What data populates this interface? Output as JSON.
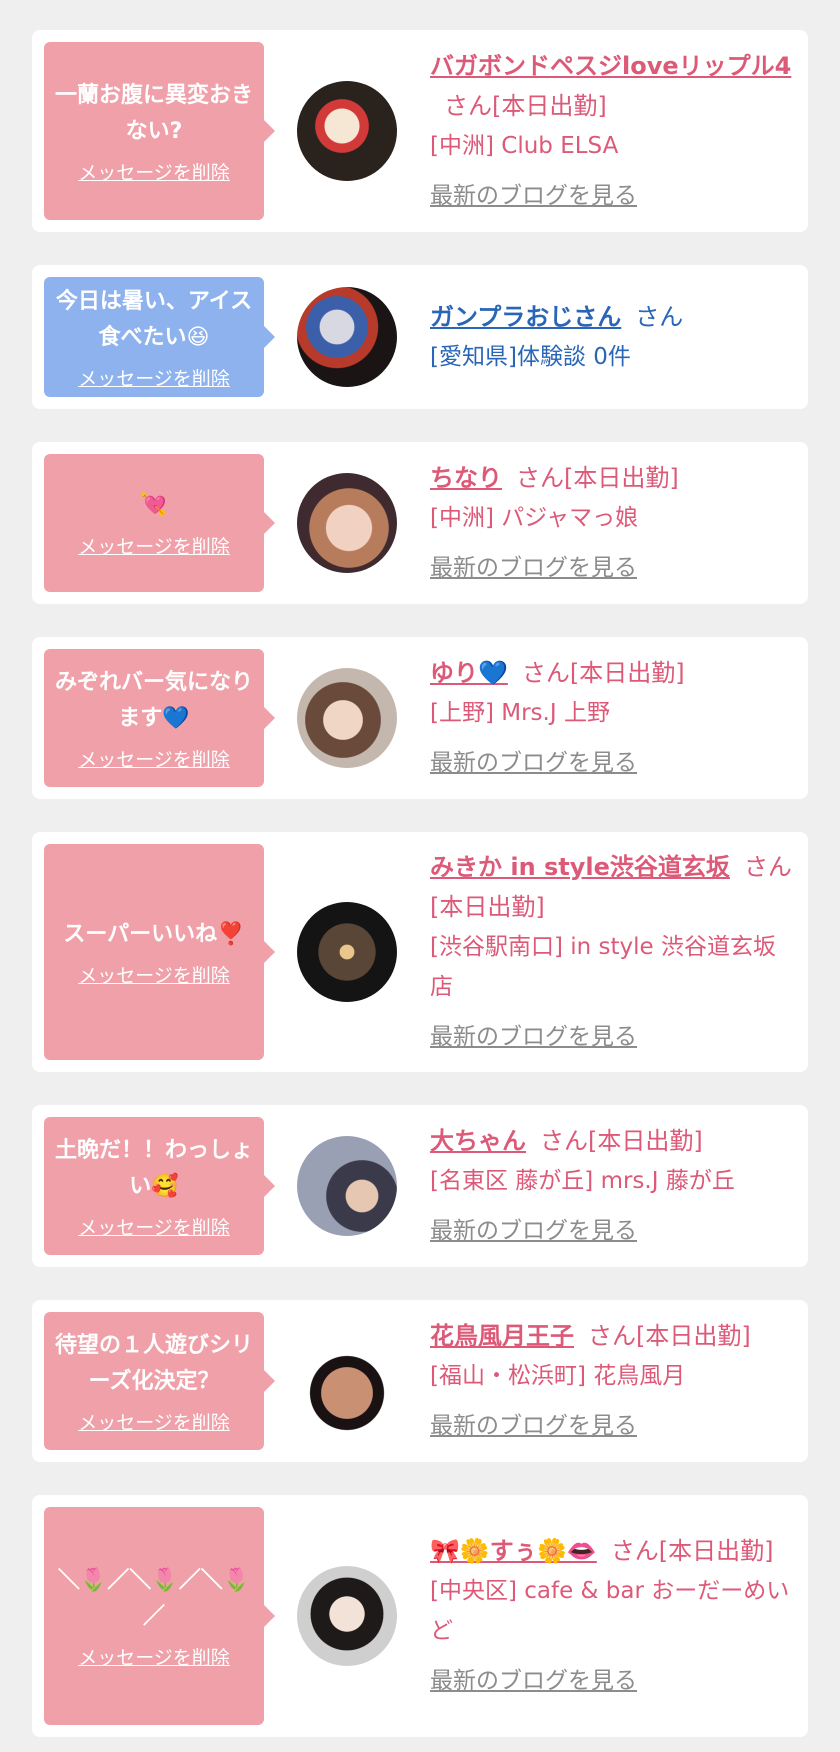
{
  "delete_label": "メッセージを削除",
  "blog_label": "最新のブログを見る",
  "cards": [
    {
      "message": "一蘭お腹に異変おきない?",
      "name": "バガボンドペスジloveリップル4",
      "suffix": "さん[本日出勤]",
      "shop": "[中洲] Club ELSA",
      "bubble_color": "#f0a0a8",
      "avatar": "avatar-clown-mask"
    },
    {
      "message": "今日は暑い、アイス食べたい😆",
      "name": "ガンプラおじさん",
      "suffix": "さん",
      "shop": "[愛知県]体験談 0件",
      "bubble_color": "#8eb2ee",
      "avatar": "avatar-gundam-model"
    },
    {
      "message": "💘",
      "name": "ちなり",
      "suffix": "さん[本日出勤]",
      "shop": "[中洲] パジャマっ娘",
      "bubble_color": "#f0a0a8",
      "avatar": "avatar-woman"
    },
    {
      "message": "みぞれバー気になります💙",
      "name": "ゆり💙",
      "suffix": "さん[本日出勤]",
      "shop": "[上野] Mrs.J 上野",
      "bubble_color": "#f0a0a8",
      "avatar": "avatar-woman-smiling"
    },
    {
      "message": "スーパーいいね❣️",
      "name": "みきか in style渋谷道玄坂",
      "suffix": "さん[本日出勤]",
      "shop": "[渋谷駅南口] in style 渋谷道玄坂店",
      "bubble_color": "#f0a0a8",
      "avatar": "avatar-dark-bar"
    },
    {
      "message": "土晩だ！！わっしょい🥰",
      "name": "大ちゃん",
      "suffix": "さん[本日出勤]",
      "shop": "[名東区 藤が丘] mrs.J 藤が丘",
      "bubble_color": "#f0a0a8",
      "avatar": "avatar-group-selfie"
    },
    {
      "message": "待望の１人遊びシリーズ化決定？",
      "name": "花鳥風月王子",
      "suffix": "さん[本日出勤]",
      "shop": "[福山・松浜町] 花鳥風月",
      "bubble_color": "#f0a0a8",
      "avatar": "avatar-man-face"
    },
    {
      "message": "＼🌷／＼🌷／＼🌷／",
      "name": "🎀🌼すぅ🌼👄",
      "suffix": "さん[本日出勤]",
      "shop": "[中央区] cafe & bar おーだーめいど",
      "bubble_color": "#f0a0a8",
      "avatar": "avatar-woman-dark-hair"
    }
  ]
}
